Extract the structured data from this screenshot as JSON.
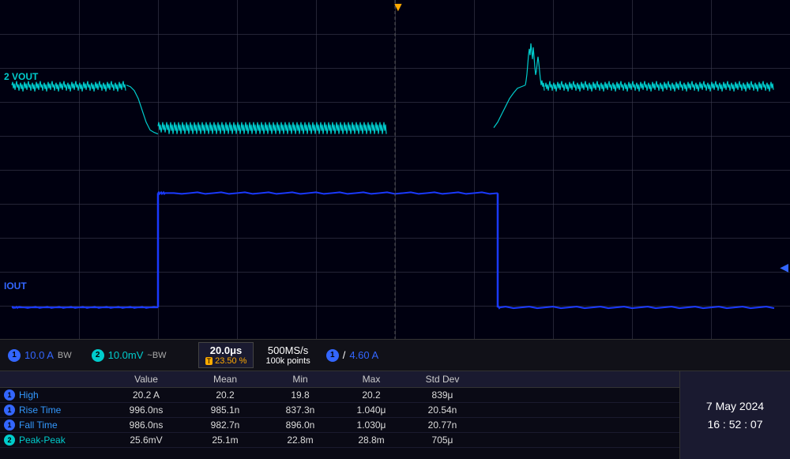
{
  "display": {
    "trigger_arrow": "▼",
    "right_arrow": "◀",
    "ch1_label": "IOUT",
    "ch2_label": "2 VOUT"
  },
  "info_bar": {
    "ch1_num": "1",
    "ch1_value": "10.0 A",
    "ch1_bw": "BW",
    "ch2_num": "2",
    "ch2_value": "10.0mV",
    "ch2_bw": "~BW",
    "time_div": "20.0μs",
    "trigger_icon": "T",
    "trigger_pct": "23.50 %",
    "sample_rate": "500MS/s",
    "sample_pts": "100k points",
    "ch1_indicator_num": "1",
    "coupling": "/",
    "measure_value": "4.60 A"
  },
  "stats": {
    "headers": [
      "",
      "Value",
      "Mean",
      "Min",
      "Max",
      "Std Dev"
    ],
    "rows": [
      {
        "ch": "1",
        "ch_color": "#3366ff",
        "label": "High",
        "label_color": "#3399ff",
        "value": "20.2 A",
        "mean": "20.2",
        "min": "19.8",
        "max": "20.2",
        "stddev": "839μ"
      },
      {
        "ch": "1",
        "ch_color": "#3366ff",
        "label": "Rise Time",
        "label_color": "#3399ff",
        "value": "996.0ns",
        "mean": "985.1n",
        "min": "837.3n",
        "max": "1.040μ",
        "stddev": "20.54n"
      },
      {
        "ch": "1",
        "ch_color": "#3366ff",
        "label": "Fall Time",
        "label_color": "#3399ff",
        "value": "986.0ns",
        "mean": "982.7n",
        "min": "896.0n",
        "max": "1.030μ",
        "stddev": "20.77n"
      },
      {
        "ch": "2",
        "ch_color": "#00cccc",
        "label": "Peak-Peak",
        "label_color": "#00cccc",
        "value": "25.6mV",
        "mean": "25.1m",
        "min": "22.8m",
        "max": "28.8m",
        "stddev": "705μ"
      }
    ]
  },
  "datetime": {
    "line1": "7 May   2024",
    "line2": "16 : 52 : 07"
  }
}
